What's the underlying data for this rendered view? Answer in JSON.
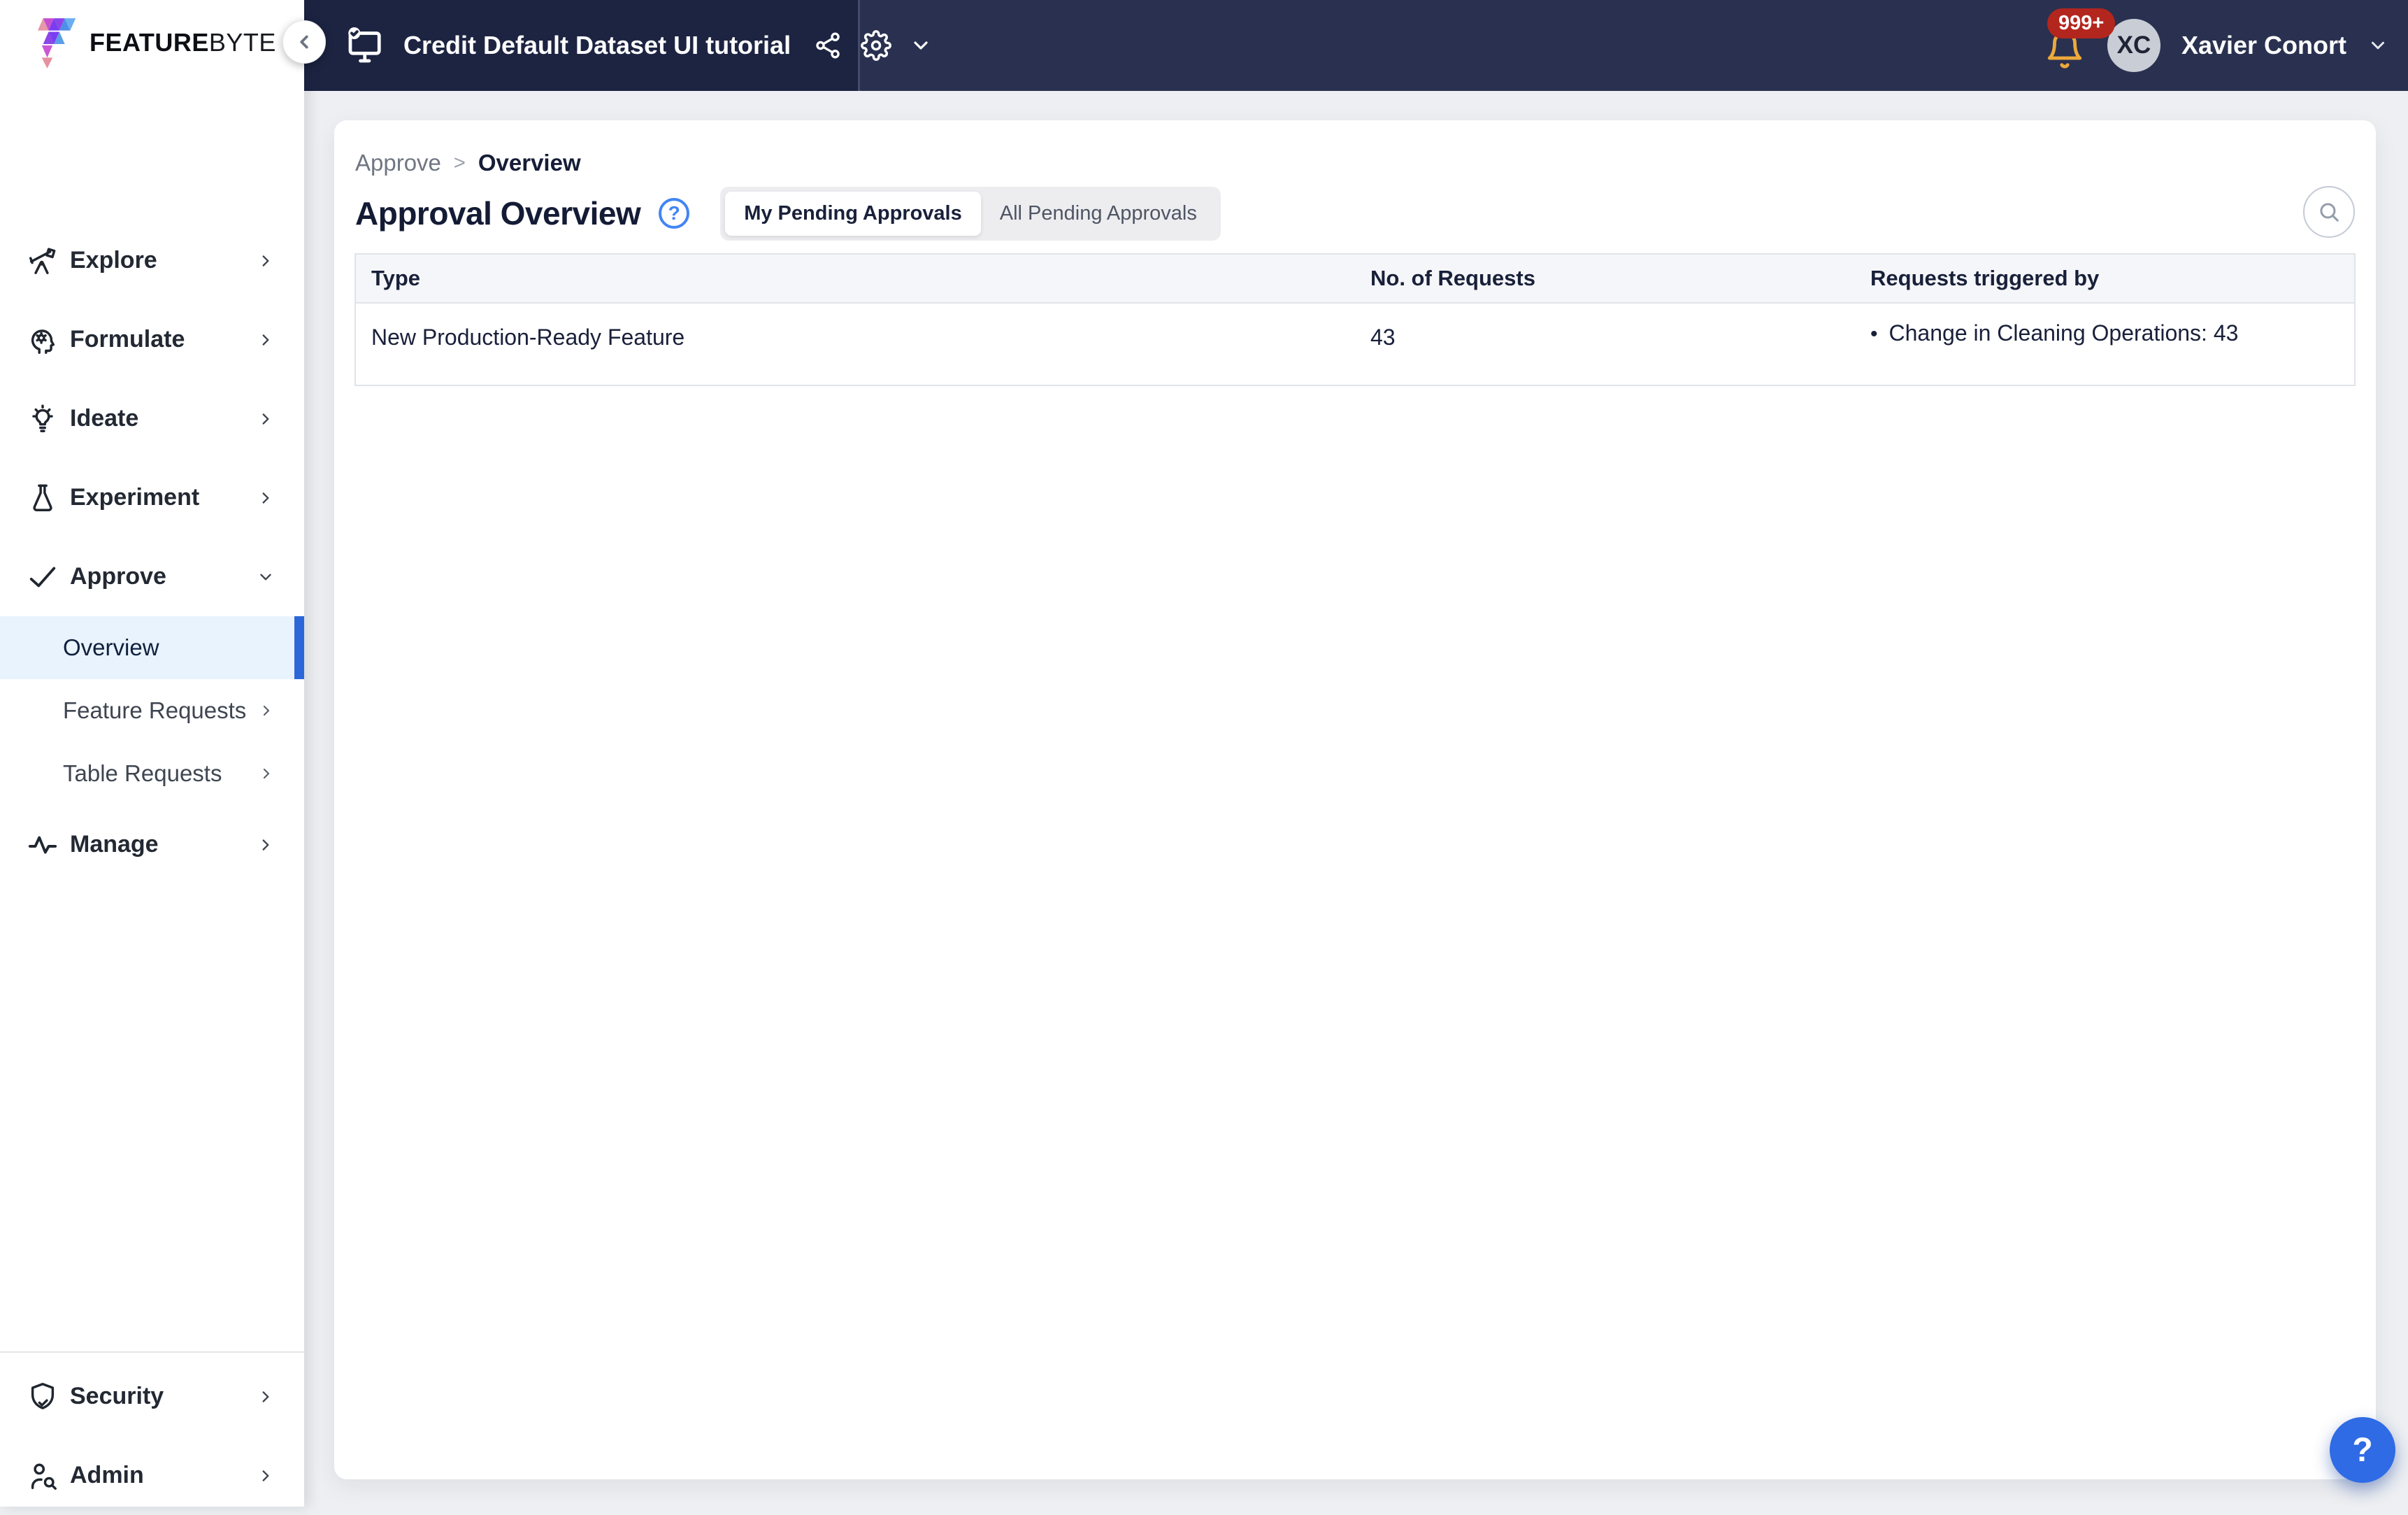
{
  "topbar": {
    "workspace_title": "Credit Default Dataset UI tutorial",
    "notifications_badge": "999+",
    "user": {
      "initials": "XC",
      "name": "Xavier Conort"
    }
  },
  "sidebar": {
    "logo": {
      "brand_bold": "FEATURE",
      "brand_light": "BYTE"
    },
    "items": [
      {
        "label": "Explore",
        "icon": "telescope-icon"
      },
      {
        "label": "Formulate",
        "icon": "head-gear-icon"
      },
      {
        "label": "Ideate",
        "icon": "lightbulb-icon"
      },
      {
        "label": "Experiment",
        "icon": "flask-icon"
      },
      {
        "label": "Approve",
        "icon": "check-icon",
        "expanded": true,
        "children": [
          {
            "label": "Overview",
            "active": true
          },
          {
            "label": "Feature Requests"
          },
          {
            "label": "Table Requests"
          }
        ]
      },
      {
        "label": "Manage",
        "icon": "activity-icon"
      }
    ],
    "footer_items": [
      {
        "label": "Security",
        "icon": "shield-check-icon"
      },
      {
        "label": "Admin",
        "icon": "user-search-icon"
      }
    ]
  },
  "main": {
    "breadcrumb": [
      "Approve",
      "Overview"
    ],
    "title": "Approval Overview",
    "tabs": [
      {
        "label": "My Pending Approvals",
        "active": true
      },
      {
        "label": "All Pending Approvals",
        "active": false
      }
    ],
    "table": {
      "columns": [
        "Type",
        "No. of Requests",
        "Requests triggered by"
      ],
      "rows": [
        {
          "type": "New Production-Ready Feature",
          "count": "43",
          "triggers": [
            "Change in Cleaning Operations: 43"
          ]
        }
      ]
    },
    "help_fab": "?"
  },
  "colors": {
    "topbar_navy_dark": "#1d2442",
    "topbar_navy": "#2a3150",
    "accent_blue": "#2c67da",
    "active_item_bg": "#e9f3fd",
    "badge_red": "#b3261e",
    "bell_amber": "#eda93b",
    "help_blue": "#4285f4",
    "fab_blue": "#2e6be5"
  }
}
